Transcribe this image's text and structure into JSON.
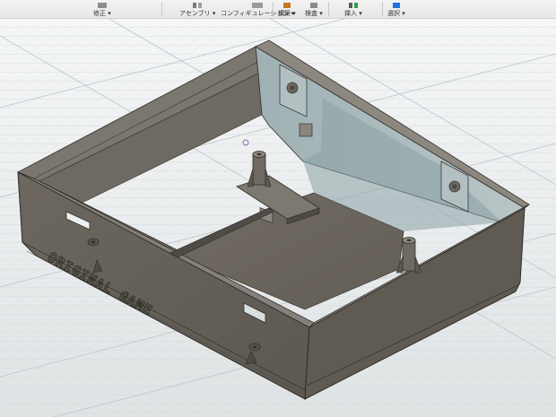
{
  "toolbar": {
    "items": [
      {
        "label": "修正 ▾",
        "icon": "modify-icon"
      },
      {
        "label": "アセンブリ ▾",
        "icon": "assemble-icon"
      },
      {
        "label": "コンフィギュレーション ▾",
        "icon": "configuration-icon"
      },
      {
        "label": "構築 ▾",
        "icon": "construct-icon"
      },
      {
        "label": "検査 ▾",
        "icon": "inspect-icon"
      },
      {
        "label": "挿入 ▾",
        "icon": "insert-icon"
      },
      {
        "label": "選択 ▾",
        "icon": "select-icon"
      }
    ]
  },
  "model": {
    "name": "enclosure-box",
    "engraved_text": "ORIGINAL GAME",
    "colors": {
      "grid": "#c9cfd1",
      "body": "#6f6a62",
      "body_dark": "#57534c",
      "body_light": "#8a857c",
      "inner_wall": "#a9b7ba",
      "floor": "#6d675e",
      "accent": "#1b73d8"
    }
  }
}
